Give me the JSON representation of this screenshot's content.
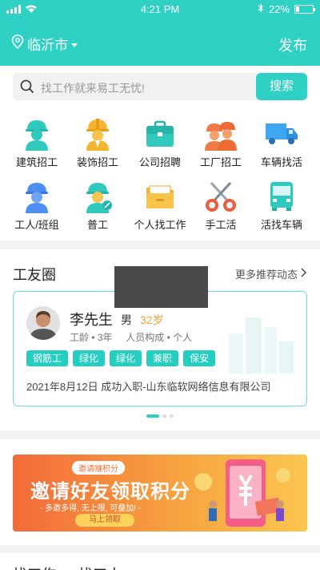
{
  "status_bar": {
    "time": "4:21 PM",
    "battery": "22%"
  },
  "header": {
    "city": "临沂市",
    "publish": "发布"
  },
  "search": {
    "placeholder": "找工作就来易工无忧!",
    "button": "搜索"
  },
  "categories": [
    {
      "label": "建筑招工",
      "icon": "construction-worker-icon"
    },
    {
      "label": "装饰招工",
      "icon": "decoration-worker-icon"
    },
    {
      "label": "公司招聘",
      "icon": "briefcase-icon"
    },
    {
      "label": "工厂招工",
      "icon": "factory-workers-icon"
    },
    {
      "label": "车辆找活",
      "icon": "truck-icon"
    },
    {
      "label": "工人/班组",
      "icon": "worker-team-icon"
    },
    {
      "label": "普工",
      "icon": "general-worker-icon"
    },
    {
      "label": "个人找工作",
      "icon": "folder-icon"
    },
    {
      "label": "手工活",
      "icon": "scissors-icon"
    },
    {
      "label": "活找车辆",
      "icon": "bus-icon"
    }
  ],
  "friends": {
    "title": "工友圈",
    "more": "更多推荐动态",
    "card": {
      "name": "李先生",
      "gender": "男",
      "age": "32岁",
      "experience": "工龄 • 3年",
      "composition": "人员构成 • 个人",
      "tags": [
        "钢筋工",
        "绿化",
        "绿化",
        "兼职",
        "保安"
      ],
      "record": "2021年8月12日  成功入职-山东临软网络信息有限公司"
    }
  },
  "banner": {
    "small": "邀请赚积分",
    "headline": "邀请好友领取积分",
    "desc": "- 多邀多得, 无上限, 可叠加! -",
    "button": "马上领取"
  },
  "bottom_tabs": [
    "找工作",
    "找工人"
  ],
  "colors": {
    "primary": "#2fd1c5",
    "accent_age": "#f0a33b",
    "banner_start": "#f36a3a",
    "banner_end": "#fbc64f"
  }
}
